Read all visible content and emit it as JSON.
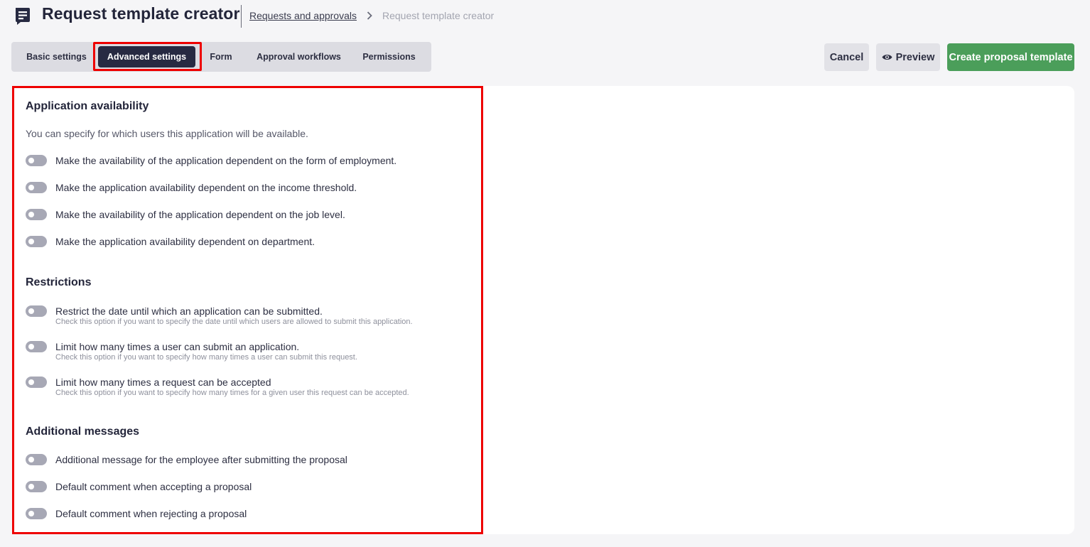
{
  "header": {
    "title": "Request template creator",
    "breadcrumb": {
      "link": "Requests and approvals",
      "current": "Request template creator"
    }
  },
  "tabs": [
    {
      "label": "Basic settings"
    },
    {
      "label": "Advanced settings"
    },
    {
      "label": "Form"
    },
    {
      "label": "Approval workflows"
    },
    {
      "label": "Permissions"
    }
  ],
  "actions": {
    "cancel": "Cancel",
    "preview": "Preview",
    "create": "Create proposal template"
  },
  "sections": {
    "availability": {
      "title": "Application availability",
      "description": "You can specify for which users this application will be available.",
      "toggles": [
        {
          "label": "Make the availability of the application dependent on the form of employment.",
          "enabled": false
        },
        {
          "label": "Make the application availability dependent on the income threshold.",
          "enabled": false
        },
        {
          "label": "Make the availability of the application dependent on the job level.",
          "enabled": false
        },
        {
          "label": "Make the application availability dependent on department.",
          "enabled": false
        }
      ]
    },
    "restrictions": {
      "title": "Restrictions",
      "toggles": [
        {
          "label": "Restrict the date until which an application can be submitted.",
          "hint": "Check this option if you want to specify the date until which users are allowed to submit this application.",
          "enabled": false
        },
        {
          "label": "Limit how many times a user can submit an application.",
          "hint": "Check this option if you want to specify how many times a user can submit this request.",
          "enabled": false
        },
        {
          "label": "Limit how many times a request can be accepted",
          "hint": "Check this option if you want to specify how many times for a given user this request can be accepted.",
          "enabled": false
        }
      ]
    },
    "messages": {
      "title": "Additional messages",
      "toggles": [
        {
          "label": "Additional message for the employee after submitting the proposal",
          "enabled": false
        },
        {
          "label": "Default comment when accepting a proposal",
          "enabled": false
        },
        {
          "label": "Default comment when rejecting a proposal",
          "enabled": false
        }
      ]
    }
  },
  "colors": {
    "primary_dark": "#272a42",
    "success": "#4b9e5a",
    "highlight": "#ee0000",
    "toggle_off": "#a7a8b5"
  },
  "active_tab": "Advanced settings"
}
